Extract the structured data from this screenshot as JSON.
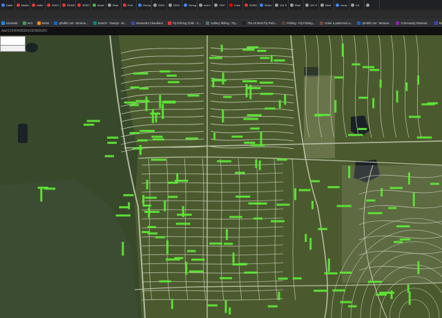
{
  "browser": {
    "tabs": [
      {
        "label": "Dash",
        "color": "#4285f4"
      },
      {
        "label": "Matrix",
        "color": "#e53935"
      },
      {
        "label": "Listin",
        "color": "#e53935"
      },
      {
        "label": "33471",
        "color": "#e53935"
      },
      {
        "label": "34940",
        "color": "#e53935"
      },
      {
        "label": "32507",
        "color": "#e53935"
      },
      {
        "label": "Answ",
        "color": "#4caf50"
      },
      {
        "label": "Real",
        "color": "#9e9e9e"
      },
      {
        "label": "Fort",
        "color": "#e53935"
      },
      {
        "label": "Georg",
        "color": "#4285f4"
      },
      {
        "label": "3333",
        "color": "#9e9e9e"
      },
      {
        "label": "3333",
        "color": "#9e9e9e"
      },
      {
        "label": "Georg",
        "color": "#4285f4"
      },
      {
        "label": "real e",
        "color": "#9e9e9e"
      },
      {
        "label": "7307",
        "color": "#9e9e9e"
      },
      {
        "label": "3 am",
        "color": "#ff0000"
      },
      {
        "label": "34951",
        "color": "#e53935"
      },
      {
        "label": "Searc",
        "color": "#4285f4"
      },
      {
        "label": "119 S",
        "color": "#9e9e9e"
      },
      {
        "label": "Real",
        "color": "#9e9e9e"
      },
      {
        "label": "119 S",
        "color": "#9e9e9e"
      },
      {
        "label": "Real",
        "color": "#9e9e9e"
      },
      {
        "label": "comp",
        "color": "#4285f4"
      },
      {
        "label": "O4",
        "color": "#9e9e9e"
      },
      {
        "label": "",
        "color": "#9e9e9e"
      }
    ],
    "bookmarks": [
      {
        "label": "minimals",
        "color": "#1e88e5"
      },
      {
        "label": "rent",
        "color": "#43a047"
      },
      {
        "label": "better",
        "color": "#fb8c00"
      },
      {
        "label": "qPublic.net - Monroe...",
        "color": "#1565c0"
      },
      {
        "label": "Search - TaxSys - M...",
        "color": "#00897b"
      },
      {
        "label": "Alexandra Chaudiere",
        "color": "#3949ab"
      },
      {
        "label": "Fly Fishing Chile - C...",
        "color": "#e53935"
      },
      {
        "label": "Gallery fishing - Fly...",
        "color": "#546e7a"
      },
      {
        "label": "The 10 Best Fly Fishi...",
        "color": "#212121"
      },
      {
        "label": "Fishing - Fly Fishing...",
        "color": "#5d4037"
      },
      {
        "label": "Order a parlezvos a...",
        "color": "#6d4c41"
      },
      {
        "label": "qPublic.net - Monroe...",
        "color": "#1565c0"
      },
      {
        "label": "Community Redevel...",
        "color": "#8e24aa"
      },
      {
        "label": "RealForeclose Mar...",
        "color": "#3949ab"
      }
    ],
    "url_strip": "Aa#1234040830/103/36002/C"
  },
  "map": {
    "land_color": "#4a5a2e",
    "forest_color": "#38482a",
    "road_color": "#c7cdb4",
    "parcel_label_color": "#5ee637",
    "water_color": "#1a2226"
  }
}
